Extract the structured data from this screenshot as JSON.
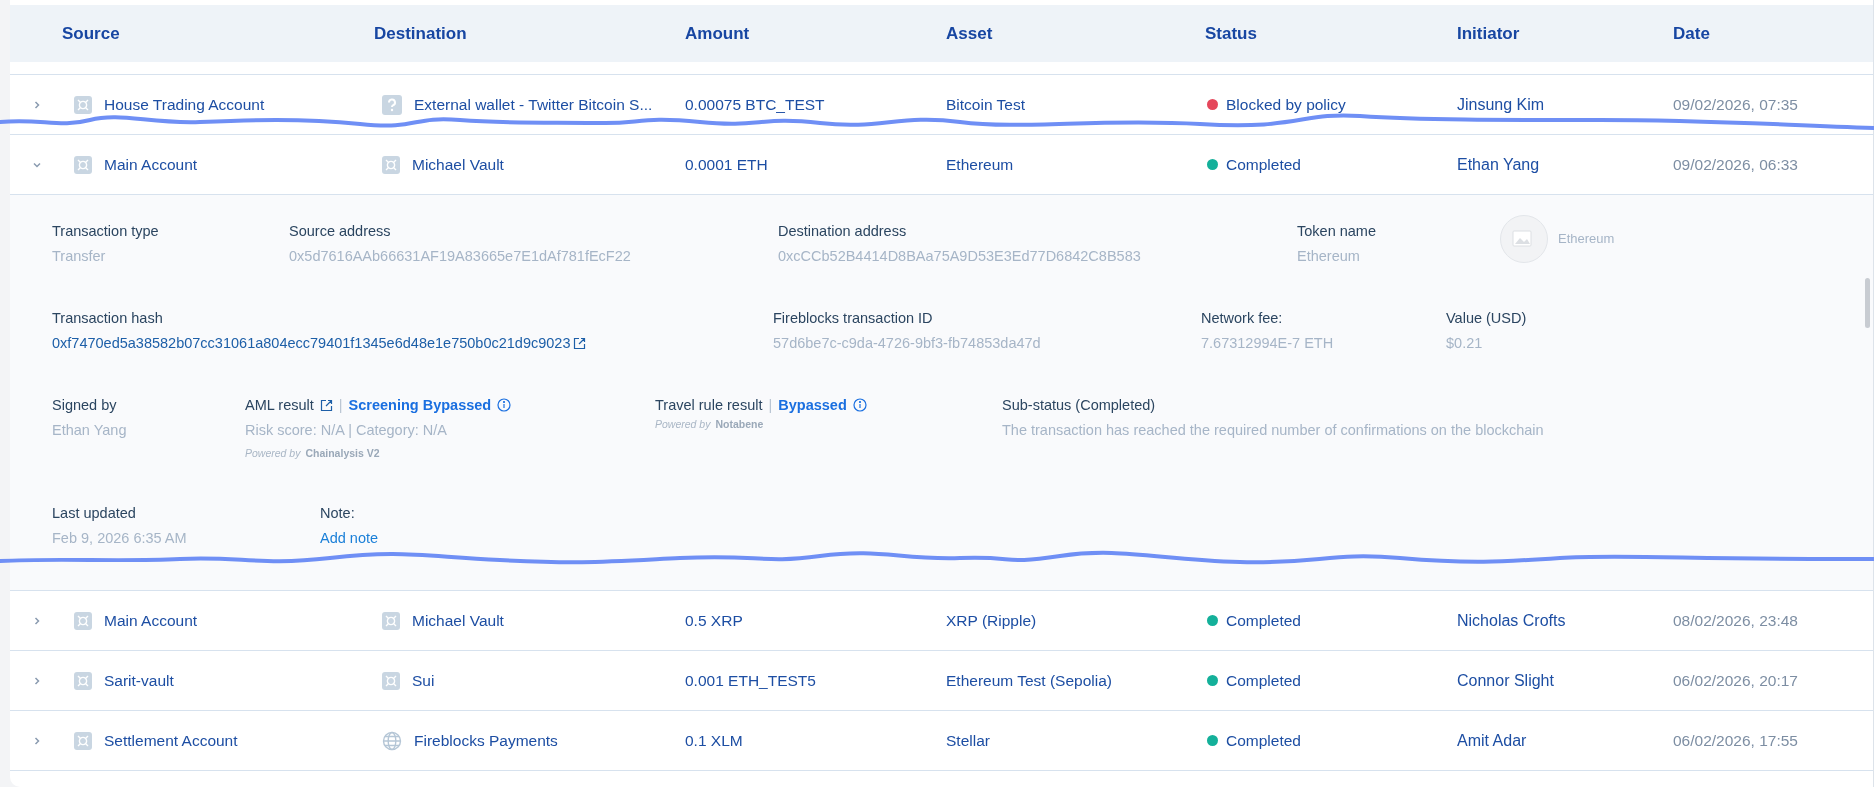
{
  "table": {
    "columns": [
      "Source",
      "Destination",
      "Amount",
      "Asset",
      "Status",
      "Initiator",
      "Date"
    ],
    "rows": [
      {
        "expanded": false,
        "source": "House Trading Account",
        "destination": {
          "kind": "unknown",
          "name": "External wallet - Twitter Bitcoin S..."
        },
        "amount": "0.00075 BTC_TEST",
        "asset": "Bitcoin Test",
        "status": {
          "label": "Blocked by policy",
          "color": "#e5475b"
        },
        "initiator": "Jinsung Kim",
        "date": "09/02/2026, 07:35"
      },
      {
        "expanded": true,
        "source": "Main Account",
        "destination": {
          "kind": "vault",
          "name": "Michael Vault"
        },
        "amount": "0.0001 ETH",
        "asset": "Ethereum",
        "status": {
          "label": "Completed",
          "color": "#14b09a"
        },
        "initiator": "Ethan Yang",
        "date": "09/02/2026, 06:33",
        "details": [
          [
            {
              "kind": "plain",
              "label": "Transaction type",
              "value": "Transfer"
            },
            {
              "kind": "plain",
              "label": "Source address",
              "value": "0x5d7616AAb66631AF19A83665e7E1dAf781fEcF22"
            },
            {
              "kind": "plain",
              "label": "Destination address",
              "value": "0xcCCb52B4414D8BAa75A9D53E3Ed77D6842C8B583"
            },
            {
              "kind": "plain",
              "label": "Token name",
              "value": "Ethereum"
            },
            {
              "kind": "token",
              "value": "Ethereum"
            }
          ],
          [
            {
              "kind": "link",
              "label": "Transaction hash",
              "value": "0xf7470ed5a38582b07cc31061a804ecc79401f1345e6d48e1e750b0c21d9c9023"
            },
            {
              "kind": "plain",
              "label": "Fireblocks transaction ID",
              "value": "57d6be7c-c9da-4726-9bf3-fb74853da47d"
            },
            {
              "kind": "plain",
              "label": "Network fee:",
              "value": "7.67312994E-7 ETH"
            },
            {
              "kind": "plain",
              "label": "Value (USD)",
              "value": "$0.21"
            }
          ],
          [
            {
              "kind": "plain",
              "label": "Signed by",
              "value": "Ethan Yang"
            },
            {
              "kind": "screening",
              "label": "AML result",
              "label_link": true,
              "separator": "|",
              "result": "Screening Bypassed",
              "value": "Risk score: N/A | Category: N/A",
              "powered_by": "Powered by",
              "provider": "Chainalysis V2"
            },
            {
              "kind": "screening",
              "label": "Travel rule result",
              "label_link": false,
              "separator": "|",
              "result": "Bypassed",
              "powered_by": "Powered by",
              "provider": "Notabene"
            },
            {
              "kind": "plain",
              "label": "Sub-status (Completed)",
              "value": "The transaction has reached the required number of confirmations on the blockchain"
            }
          ],
          [
            {
              "kind": "plain",
              "label": "Last updated",
              "value": "Feb 9, 2026 6:35 AM"
            },
            {
              "kind": "action",
              "label": "Note:",
              "value": "Add note"
            }
          ]
        ]
      },
      {
        "expanded": false,
        "source": "Main Account",
        "destination": {
          "kind": "vault",
          "name": "Michael Vault"
        },
        "amount": "0.5 XRP",
        "asset": "XRP (Ripple)",
        "status": {
          "label": "Completed",
          "color": "#14b09a"
        },
        "initiator": "Nicholas Crofts",
        "date": "08/02/2026, 23:48"
      },
      {
        "expanded": false,
        "source": "Sarit-vault",
        "destination": {
          "kind": "vault",
          "name": "Sui"
        },
        "amount": "0.001 ETH_TEST5",
        "asset": "Ethereum Test (Sepolia)",
        "status": {
          "label": "Completed",
          "color": "#14b09a"
        },
        "initiator": "Connor Slight",
        "date": "06/02/2026, 20:17"
      },
      {
        "expanded": false,
        "source": "Settlement Account",
        "destination": {
          "kind": "network",
          "name": "Fireblocks Payments"
        },
        "amount": "0.1 XLM",
        "asset": "Stellar",
        "status": {
          "label": "Completed",
          "color": "#14b09a"
        },
        "initiator": "Amit Adar",
        "date": "06/02/2026, 17:55"
      }
    ]
  }
}
